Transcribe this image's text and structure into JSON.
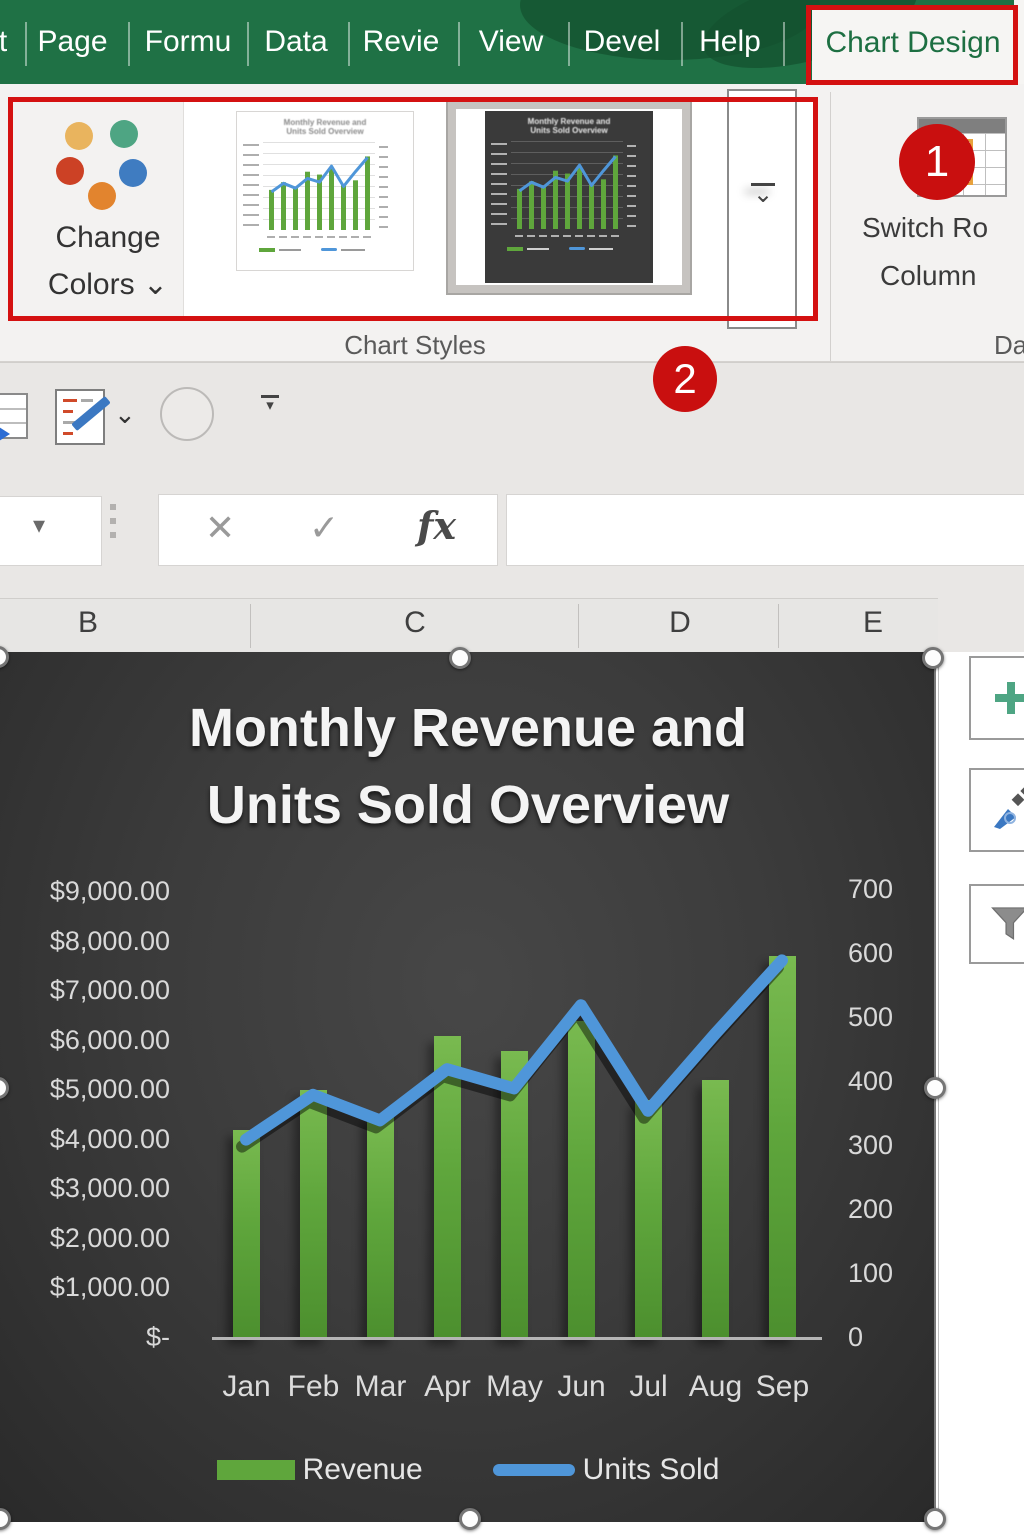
{
  "ribbon": {
    "tabs": [
      "t",
      "Page",
      "Formu",
      "Data",
      "Revie",
      "View",
      "Devel",
      "Help",
      "Chart Design"
    ],
    "active_tab": "Chart Design",
    "groups": {
      "chart_styles": {
        "label": "Chart Styles",
        "change_colors": {
          "line1": "Change",
          "line2": "Colors ⌄"
        },
        "gallery_selected_index": 1
      },
      "data": {
        "label": "Da",
        "switch_button": {
          "line1": "Switch Ro",
          "line2": "Column"
        }
      }
    }
  },
  "annotations": {
    "badge1": "1",
    "badge2": "2",
    "highlight_color": "#d41111"
  },
  "icons": {
    "more_chevron": "⌄",
    "qat_chevron": "⌄",
    "qat_customize_arrow": "▾",
    "name_box_dropdown": "▾",
    "cancel": "✕",
    "enter": "✓",
    "insert_function": "fx",
    "add_chart_element": "+"
  },
  "formula_bar": {
    "name_box_value": "",
    "formula_value": ""
  },
  "column_headers": [
    "B",
    "C",
    "D",
    "E"
  ],
  "chart_data": {
    "type": "combo",
    "title": "Monthly Revenue and Units Sold Overview",
    "title_lines": [
      "Monthly Revenue and",
      "Units Sold Overview"
    ],
    "categories": [
      "Jan",
      "Feb",
      "Mar",
      "Apr",
      "May",
      "Jun",
      "Jul",
      "Aug",
      "Sep"
    ],
    "series": [
      {
        "name": "Revenue",
        "type": "bar",
        "axis": "primary",
        "color": "#5fa63c",
        "values": [
          4200,
          5000,
          4500,
          6100,
          5800,
          6400,
          4800,
          5200,
          7700
        ]
      },
      {
        "name": "Units Sold",
        "type": "line",
        "axis": "secondary",
        "color": "#4f96d9",
        "values": [
          310,
          380,
          340,
          420,
          390,
          520,
          355,
          475,
          590
        ]
      }
    ],
    "primary_axis": {
      "min": 0,
      "max": 9000,
      "step": 1000,
      "tick_labels": [
        "$-",
        "$1,000.00",
        "$2,000.00",
        "$3,000.00",
        "$4,000.00",
        "$5,000.00",
        "$6,000.00",
        "$7,000.00",
        "$8,000.00",
        "$9,000.00"
      ]
    },
    "secondary_axis": {
      "min": 0,
      "max": 700,
      "step": 100,
      "tick_labels": [
        "0",
        "100",
        "200",
        "300",
        "400",
        "500",
        "600",
        "700"
      ]
    },
    "legend": {
      "position": "bottom",
      "entries": [
        "Revenue",
        "Units Sold"
      ]
    },
    "plot_background": "dark",
    "gridlines": false
  }
}
